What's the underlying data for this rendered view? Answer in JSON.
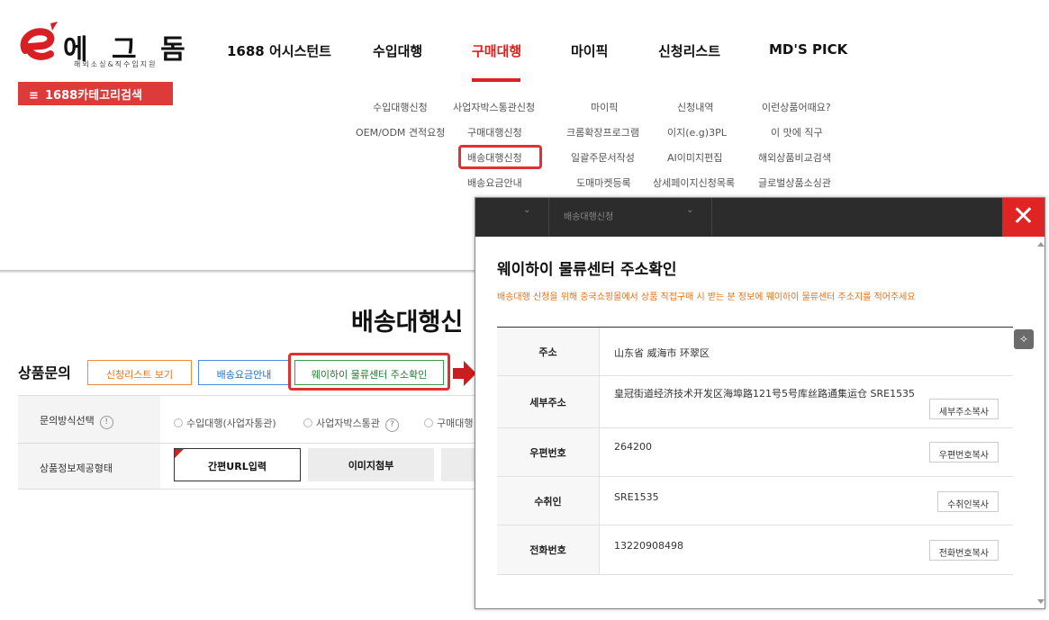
{
  "logo": {
    "mark": "e",
    "name": "에 그 돔",
    "tagline": "해외소싱&직수입지원"
  },
  "gnb": [
    "1688 어시스턴트",
    "수입대행",
    "구매대행",
    "마이픽",
    "신청리스트",
    "MD'S PICK"
  ],
  "category_button": "1688카테고리검색",
  "submenu": {
    "col1": [
      "수입대행신청",
      "OEM/ODM 견적요청"
    ],
    "col2": [
      "사업자박스통관신청",
      "구매대행신청",
      "배송대행신청",
      "배송요금안내"
    ],
    "col3": [
      "마이픽",
      "크롬확장프로그램",
      "일괄주문서작성",
      "도매마켓등록"
    ],
    "col4": [
      "신청내역",
      "이지(e.g)3PL",
      "AI이미지편집",
      "상세페이지신청목록"
    ],
    "col5": [
      "이런상품어때요?",
      "이 맛에 직구",
      "해외상품비교검색",
      "글로벌상품소싱관"
    ]
  },
  "page": {
    "title": "배송대행신",
    "section_title": "상품문의",
    "buttons": {
      "list": "신청리스트 보기",
      "fee": "배송요금안내",
      "address": "웨이하이 물류센터 주소확인"
    },
    "rows": {
      "method_label": "문의방식선택",
      "method_help": "!",
      "options": [
        "수입대행(사업자통관)",
        "사업자박스통관",
        "구매대행"
      ],
      "option_help": "?",
      "info_label": "상품정보제공형태",
      "info_buttons": [
        "간편URL입력",
        "이미지첨부"
      ]
    }
  },
  "modal": {
    "header_dropdown_1": "⌄",
    "header_dropdown_2_label": "배송대행신청",
    "header_dropdown_2_chevron": "⌄",
    "close": "✕",
    "title": "웨이하이 물류센터 주소확인",
    "description": "배송대행 신청을 위해 중국쇼핑몰에서 상품 직접구매 시 받는 분 정보에 웨이하이 물류센터 주소지를 적어주세요",
    "rows": [
      {
        "label": "주소",
        "value": "山东省 威海市 环翠区",
        "button": ""
      },
      {
        "label": "세부주소",
        "value": "皇冠街道经济技术开发区海埠路121号5号库丝路通集运仓 SRE1535",
        "button": "세부주소복사"
      },
      {
        "label": "우편번호",
        "value": "264200",
        "button": "우편번호복사"
      },
      {
        "label": "수취인",
        "value": "SRE1535",
        "button": "수취인복사"
      },
      {
        "label": "전화번호",
        "value": "13220908498",
        "button": "전화번호복사"
      }
    ]
  },
  "colors": {
    "brand_red": "#e02020",
    "accent_orange": "#e8701a",
    "highlight": "#e03030"
  }
}
